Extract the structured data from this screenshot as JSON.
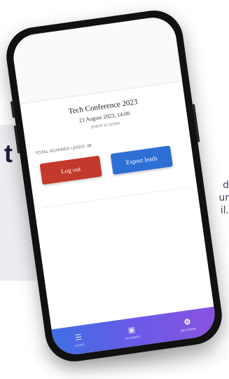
{
  "background": {
    "heading_fragment": "t",
    "text_fragments": [
      "d",
      "ur",
      "il."
    ]
  },
  "event": {
    "title": "Tech Conference 2023",
    "datetime": "21 August 2023, 14:00",
    "event_id": "EVENT ID 123456"
  },
  "total_leads_label": "TOTAL SCANNED LEADS: 48",
  "buttons": {
    "logout": "Log out",
    "export": "Export leads"
  },
  "tabs": [
    {
      "label": "LEADS",
      "icon": "list-icon",
      "glyph": "☰"
    },
    {
      "label": "SCANNER",
      "icon": "scanner-icon",
      "glyph": "▣"
    },
    {
      "label": "SETTINGS",
      "icon": "gear-icon",
      "glyph": "⚙"
    }
  ],
  "colors": {
    "logout": "#c3392b",
    "export": "#2e6fd6",
    "tabbar_start": "#3f6fe3",
    "tabbar_end": "#8a52e0"
  }
}
